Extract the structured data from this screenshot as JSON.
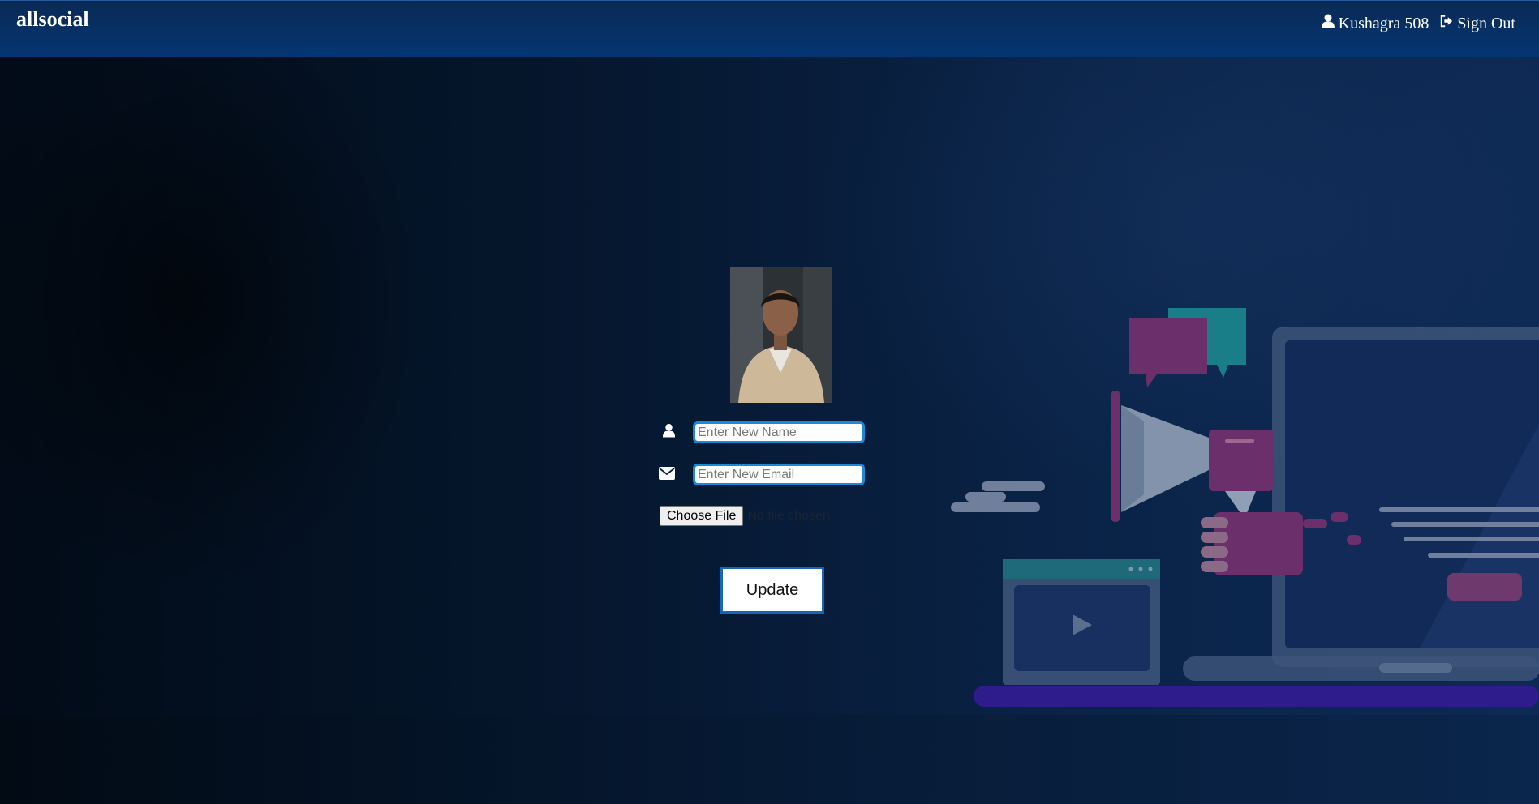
{
  "navbar": {
    "brand": "allsocial",
    "user_label": "Kushagra 508",
    "signout_label": "Sign Out"
  },
  "profile_form": {
    "name_placeholder": "Enter New Name",
    "email_placeholder": "Enter New Email",
    "file_button_label": "Choose File",
    "file_status": "No file chosen",
    "update_label": "Update"
  },
  "colors": {
    "navbar": "#043572",
    "input_border": "#1a8ad8",
    "update_border": "#1466b8"
  },
  "icons": {
    "user": "user-icon",
    "signout": "sign-out-icon",
    "name_field": "user-icon",
    "email_field": "envelope-icon"
  }
}
